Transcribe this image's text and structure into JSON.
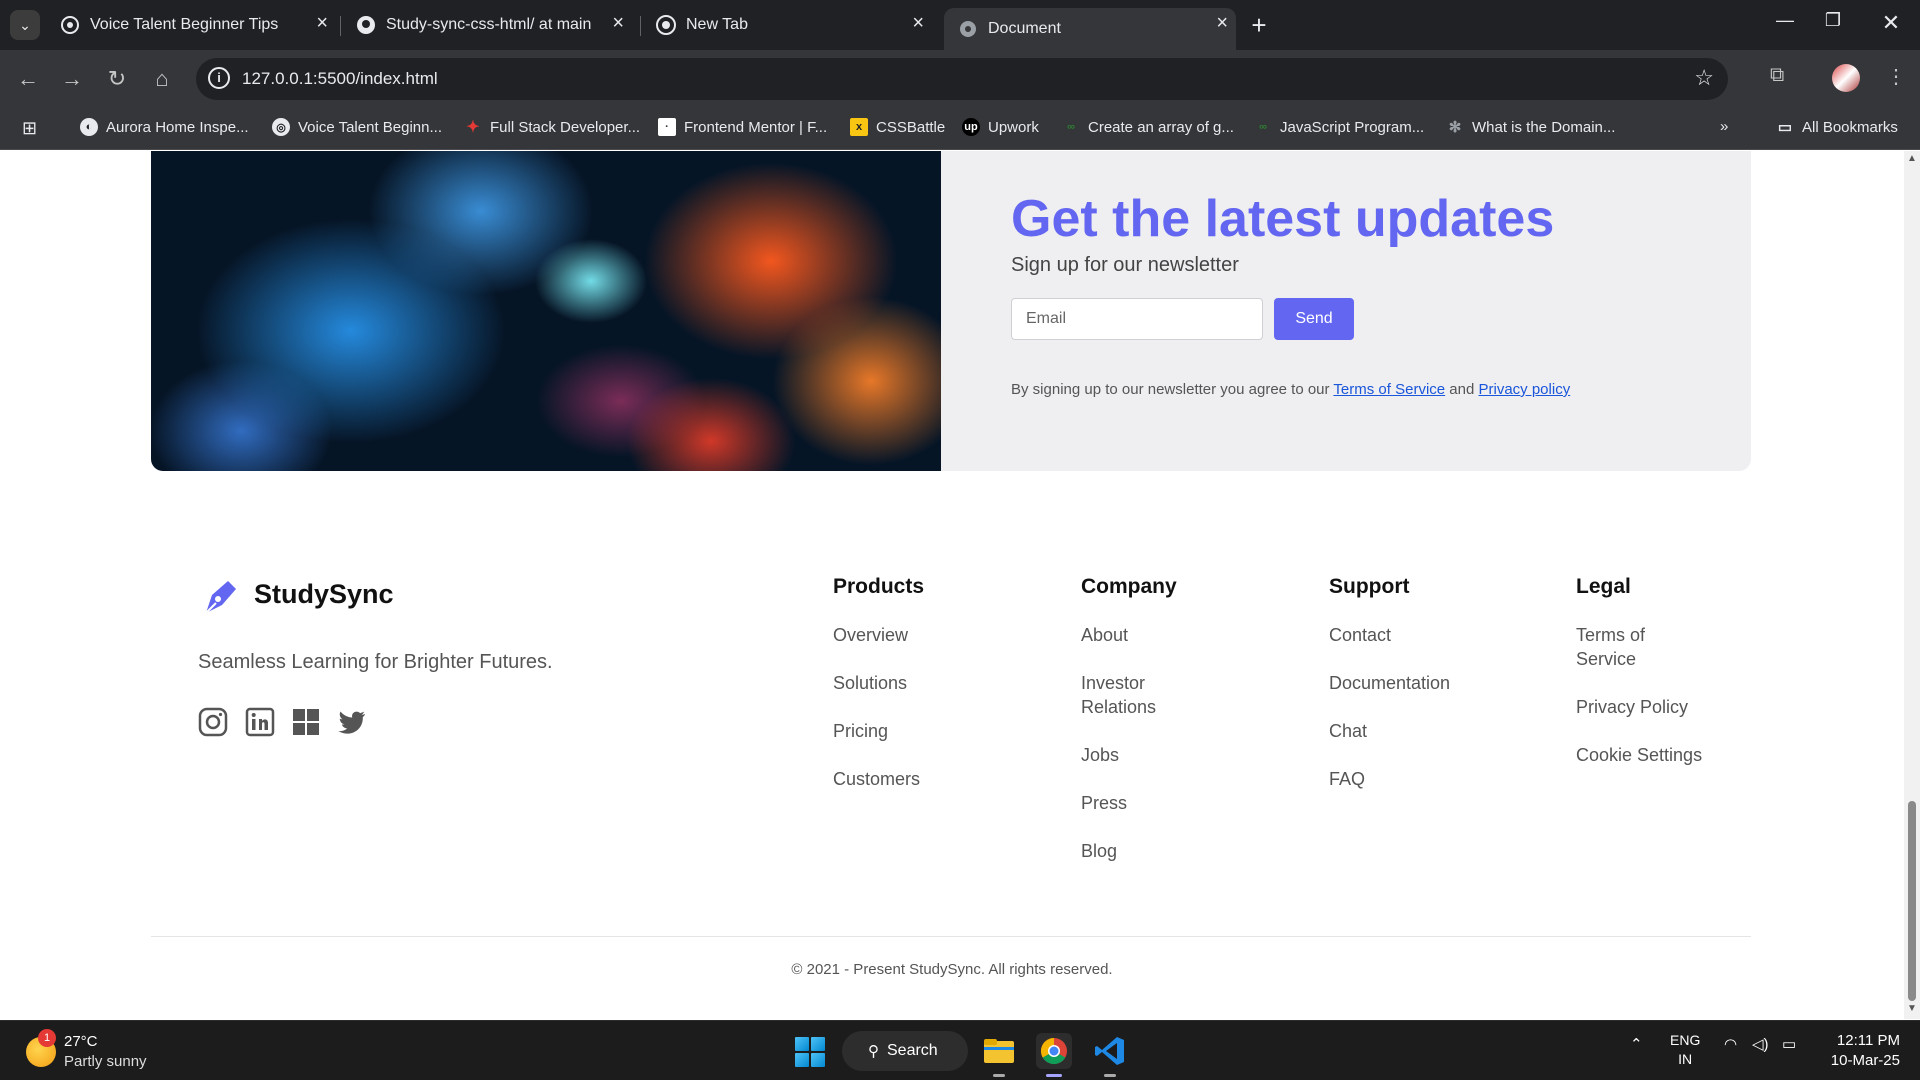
{
  "browser": {
    "tabs": [
      {
        "title": "Voice Talent Beginner Tips",
        "favicon": "openai-icon"
      },
      {
        "title": "Study-sync-css-html/ at main · ",
        "favicon": "github-icon"
      },
      {
        "title": "New Tab",
        "favicon": "chrome-icon"
      },
      {
        "title": "Document",
        "favicon": "globe-icon",
        "active": true
      }
    ],
    "url": "127.0.0.1:5500/index.html",
    "bookmarks": [
      "Aurora Home Inspe...",
      "Voice Talent Beginn...",
      "Full Stack Developer...",
      "Frontend Mentor | F...",
      "CSSBattle",
      "Upwork",
      "Create an array of g...",
      "JavaScript Program...",
      "What is the Domain..."
    ],
    "all_bookmarks": "All Bookmarks"
  },
  "newsletter": {
    "title": "Get the latest updates",
    "subtitle": "Sign up for our newsletter",
    "email_placeholder": "Email",
    "send_label": "Send",
    "legal_prefix": "By signing up to our newsletter you agree to our ",
    "terms_link": "Terms of Service",
    "legal_and": " and ",
    "privacy_link": "Privacy policy",
    "accent": "#6366f1"
  },
  "brand": {
    "name": "StudySync",
    "tagline": "Seamless Learning for Brighter Futures.",
    "social": [
      "instagram-icon",
      "linkedin-icon",
      "windows-icon",
      "twitter-icon"
    ]
  },
  "footer": {
    "columns": [
      {
        "heading": "Products",
        "links": [
          "Overview",
          "Solutions",
          "Pricing",
          "Customers"
        ]
      },
      {
        "heading": "Company",
        "links": [
          "About",
          "Investor Relations",
          "Jobs",
          "Press",
          "Blog"
        ]
      },
      {
        "heading": "Support",
        "links": [
          "Contact",
          "Documentation",
          "Chat",
          "FAQ"
        ]
      },
      {
        "heading": "Legal",
        "links": [
          "Terms of Service",
          "Privacy Policy",
          "Cookie Settings"
        ]
      }
    ],
    "copyright": "© 2021 - Present StudySync. All rights reserved."
  },
  "taskbar": {
    "weather_badge": "1",
    "weather_temp": "27°C",
    "weather_desc": "Partly sunny",
    "search_label": "Search",
    "lang_1": "ENG",
    "lang_2": "IN",
    "time": "12:11 PM",
    "date": "10-Mar-25"
  }
}
